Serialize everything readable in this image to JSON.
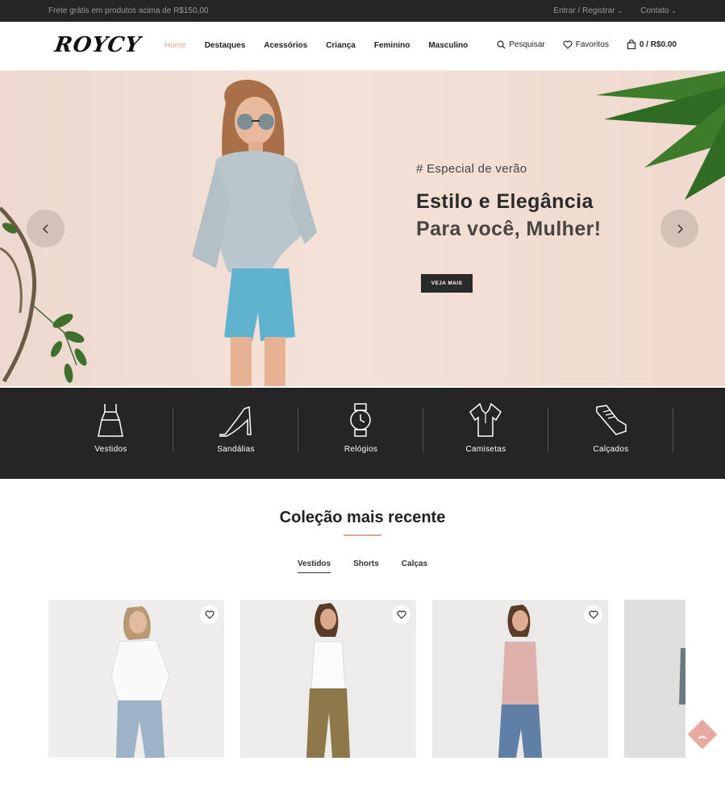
{
  "topbar": {
    "promo": "Frete grátis em produtos acima de R$150,00",
    "login": "Entrar / Registrar",
    "contact": "Contato"
  },
  "header": {
    "logo": "ROYCY",
    "nav": [
      "Home",
      "Destaques",
      "Acessórios",
      "Criança",
      "Feminino",
      "Masculino"
    ],
    "search_label": "Pesquisar",
    "favorites_label": "Favoritos",
    "cart_label": "0 / R$0.00"
  },
  "hero": {
    "tag": "# Especial de verão",
    "title_line1": "Estilo e Elegância",
    "title_line2": "Para você, Mulher!",
    "cta": "VEJA MAIS"
  },
  "categories": [
    {
      "label": "Vestidos",
      "icon": "dress-icon"
    },
    {
      "label": "Sandálias",
      "icon": "heel-icon"
    },
    {
      "label": "Relógios",
      "icon": "watch-icon"
    },
    {
      "label": "Camisetas",
      "icon": "shirt-icon"
    },
    {
      "label": "Calçados",
      "icon": "sneaker-icon"
    }
  ],
  "collection": {
    "title": "Coleção mais recente",
    "tabs": [
      "Vestidos",
      "Shorts",
      "Calças"
    ],
    "active_tab": "Vestidos"
  },
  "colors": {
    "accent": "#dba59a",
    "dark": "#252525"
  }
}
